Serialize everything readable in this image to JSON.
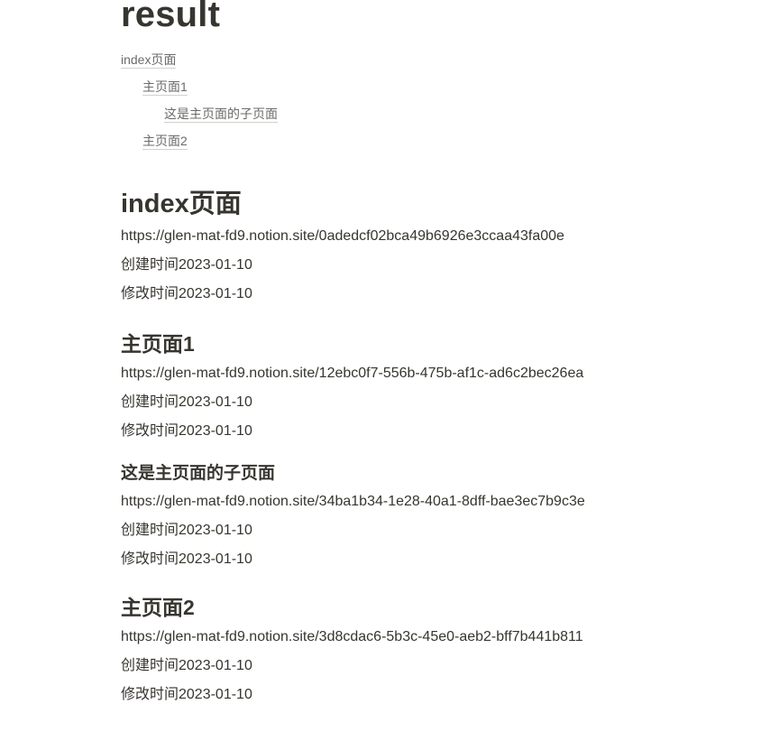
{
  "title": "result",
  "toc": [
    {
      "label": "index页面",
      "level": 1
    },
    {
      "label": "主页面1",
      "level": 2
    },
    {
      "label": "这是主页面的子页面",
      "level": 3
    },
    {
      "label": "主页面2",
      "level": 2
    }
  ],
  "sections": [
    {
      "heading": "index页面",
      "url": "https://glen-mat-fd9.notion.site/0adedcf02bca49b6926e3ccaa43fa00e",
      "created": "创建时间2023-01-10",
      "modified": "修改时间2023-01-10"
    },
    {
      "heading": "主页面1",
      "url": "https://glen-mat-fd9.notion.site/12ebc0f7-556b-475b-af1c-ad6c2bec26ea",
      "created": "创建时间2023-01-10",
      "modified": "修改时间2023-01-10"
    },
    {
      "heading": "这是主页面的子页面",
      "url": "https://glen-mat-fd9.notion.site/34ba1b34-1e28-40a1-8dff-bae3ec7b9c3e",
      "created": "创建时间2023-01-10",
      "modified": "修改时间2023-01-10"
    },
    {
      "heading": "主页面2",
      "url": "https://glen-mat-fd9.notion.site/3d8cdac6-5b3c-45e0-aeb2-bff7b441b811",
      "created": "创建时间2023-01-10",
      "modified": "修改时间2023-01-10"
    }
  ]
}
